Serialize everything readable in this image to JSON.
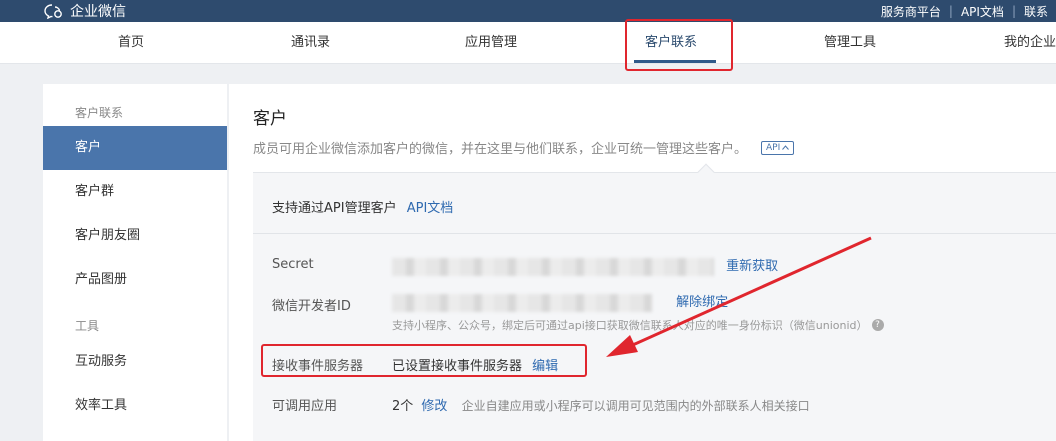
{
  "topbar": {
    "logo_text": "企业微信",
    "links": [
      "服务商平台",
      "API文档",
      "联系"
    ]
  },
  "nav": {
    "items": [
      {
        "label": "首页"
      },
      {
        "label": "通讯录"
      },
      {
        "label": "应用管理"
      },
      {
        "label": "客户联系",
        "active": true
      },
      {
        "label": "管理工具"
      },
      {
        "label": "我的企业"
      }
    ]
  },
  "sidebar": {
    "group1": "客户联系",
    "items1": [
      "客户",
      "客户群",
      "客户朋友圈",
      "产品图册"
    ],
    "group2": "工具",
    "items2": [
      "互动服务",
      "效率工具"
    ]
  },
  "main": {
    "title": "客户",
    "desc": "成员可用企业微信添加客户的微信，并在这里与他们联系，企业可统一管理这些客户。",
    "api_badge": "API",
    "panel": {
      "head_text": "支持通过API管理客户",
      "head_link": "API文档",
      "secret": {
        "label": "Secret",
        "action": "重新获取"
      },
      "dev_id": {
        "label": "微信开发者ID",
        "action": "解除绑定",
        "hint": "支持小程序、公众号，绑定后可通过api接口获取微信联系人对应的唯一身份标识（微信unionid）"
      },
      "event_server": {
        "label": "接收事件服务器",
        "value": "已设置接收事件服务器",
        "action": "编辑"
      },
      "apps": {
        "label": "可调用应用",
        "count": "2个",
        "action": "修改",
        "desc": "企业自建应用或小程序可以调用可见范围内的外部联系人相关接口"
      }
    }
  },
  "colors": {
    "topbar": "#2e4b6e",
    "accent": "#4a75ab",
    "link": "#2f6ab0",
    "highlight": "#e0262e"
  }
}
